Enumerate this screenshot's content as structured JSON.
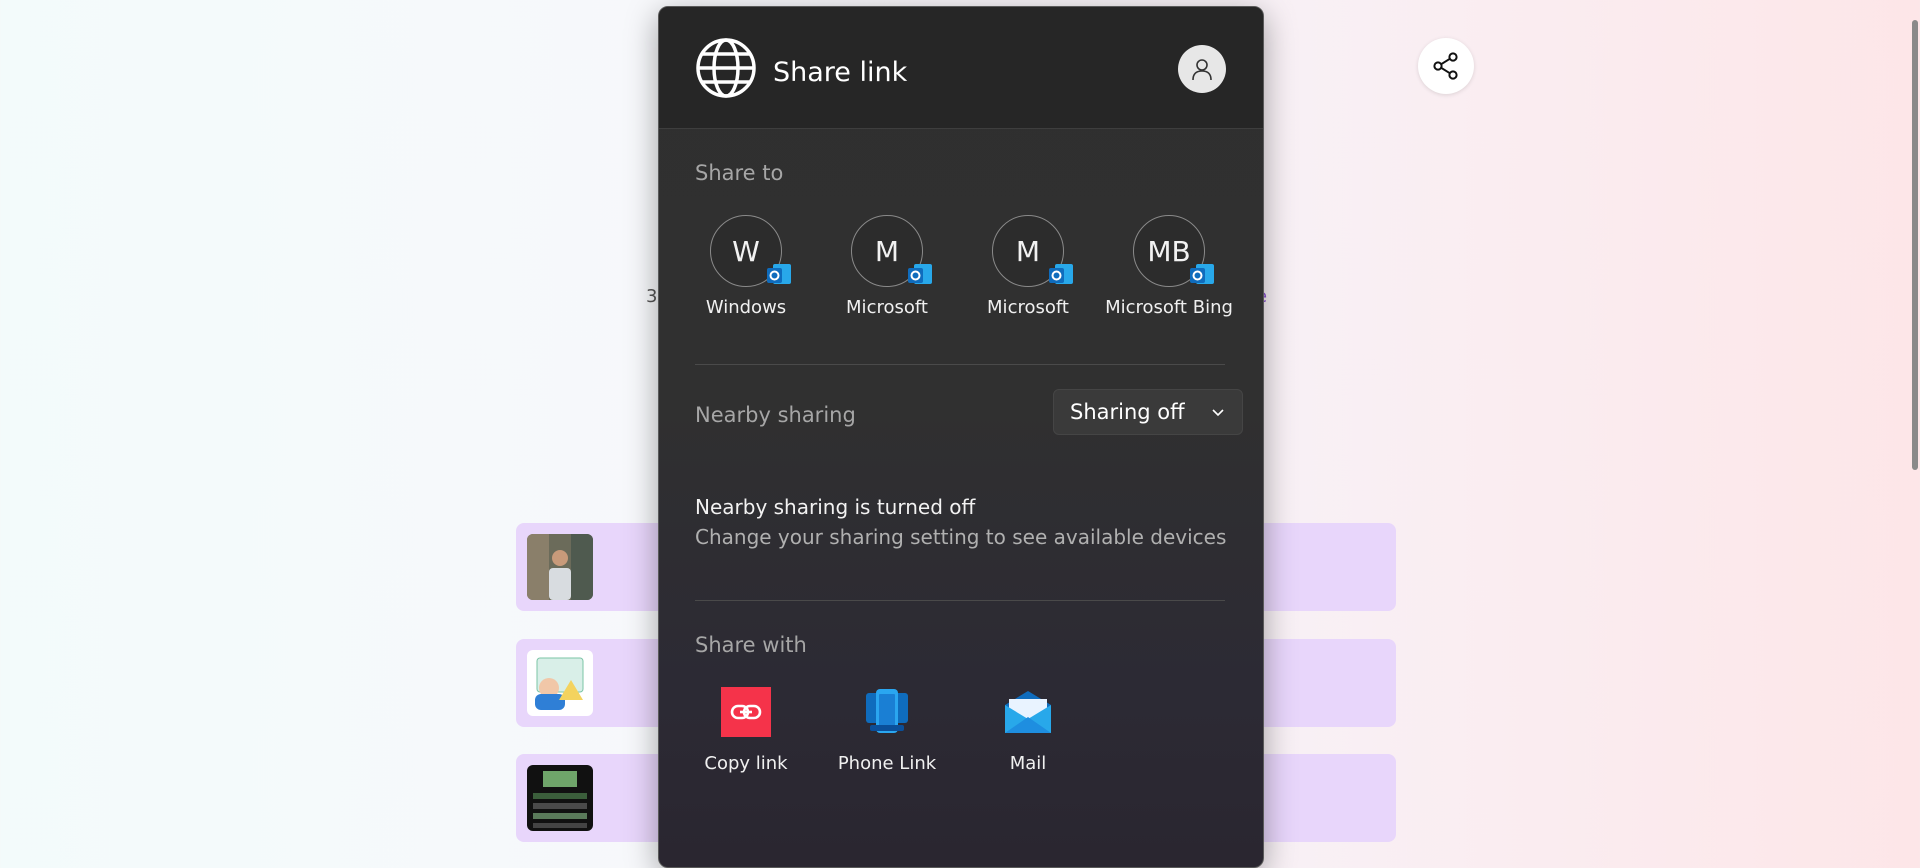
{
  "dialog": {
    "title": "Share link",
    "share_to_label": "Share to",
    "contacts": [
      {
        "initials": "W",
        "name": "Windows"
      },
      {
        "initials": "M",
        "name": "Microsoft"
      },
      {
        "initials": "M",
        "name": "Microsoft"
      },
      {
        "initials": "MB",
        "name": "Microsoft Bing"
      }
    ],
    "nearby_label": "Nearby sharing",
    "nearby_dropdown": "Sharing off",
    "nearby_status_title": "Nearby sharing is turned off",
    "nearby_status_sub": "Change your sharing setting to see available devices",
    "share_with_label": "Share with",
    "apps": [
      {
        "name": "Copy link",
        "icon": "copy-link-icon"
      },
      {
        "name": "Phone Link",
        "icon": "phone-link-icon"
      },
      {
        "name": "Mail",
        "icon": "mail-icon"
      }
    ]
  },
  "background": {
    "frag_left": "3",
    "frag_right": "e"
  },
  "colors": {
    "dialog_bg": "#2f2f2f",
    "header_bg": "#262626",
    "card_bg": "#e8d6fb",
    "copy_link_red": "#f5334a",
    "outlook_blue": "#0f6cbd"
  }
}
